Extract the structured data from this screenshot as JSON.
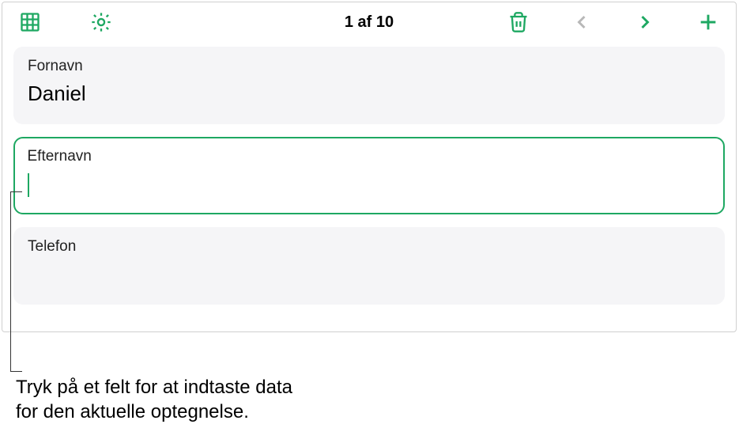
{
  "toolbar": {
    "counter": "1 af 10"
  },
  "fields": [
    {
      "label": "Fornavn",
      "value": "Daniel",
      "active": false
    },
    {
      "label": "Efternavn",
      "value": "",
      "active": true
    },
    {
      "label": "Telefon",
      "value": "",
      "active": false
    }
  ],
  "callout": {
    "line1": "Tryk på et felt for at indtaste data",
    "line2": "for den aktuelle optegnelse."
  }
}
